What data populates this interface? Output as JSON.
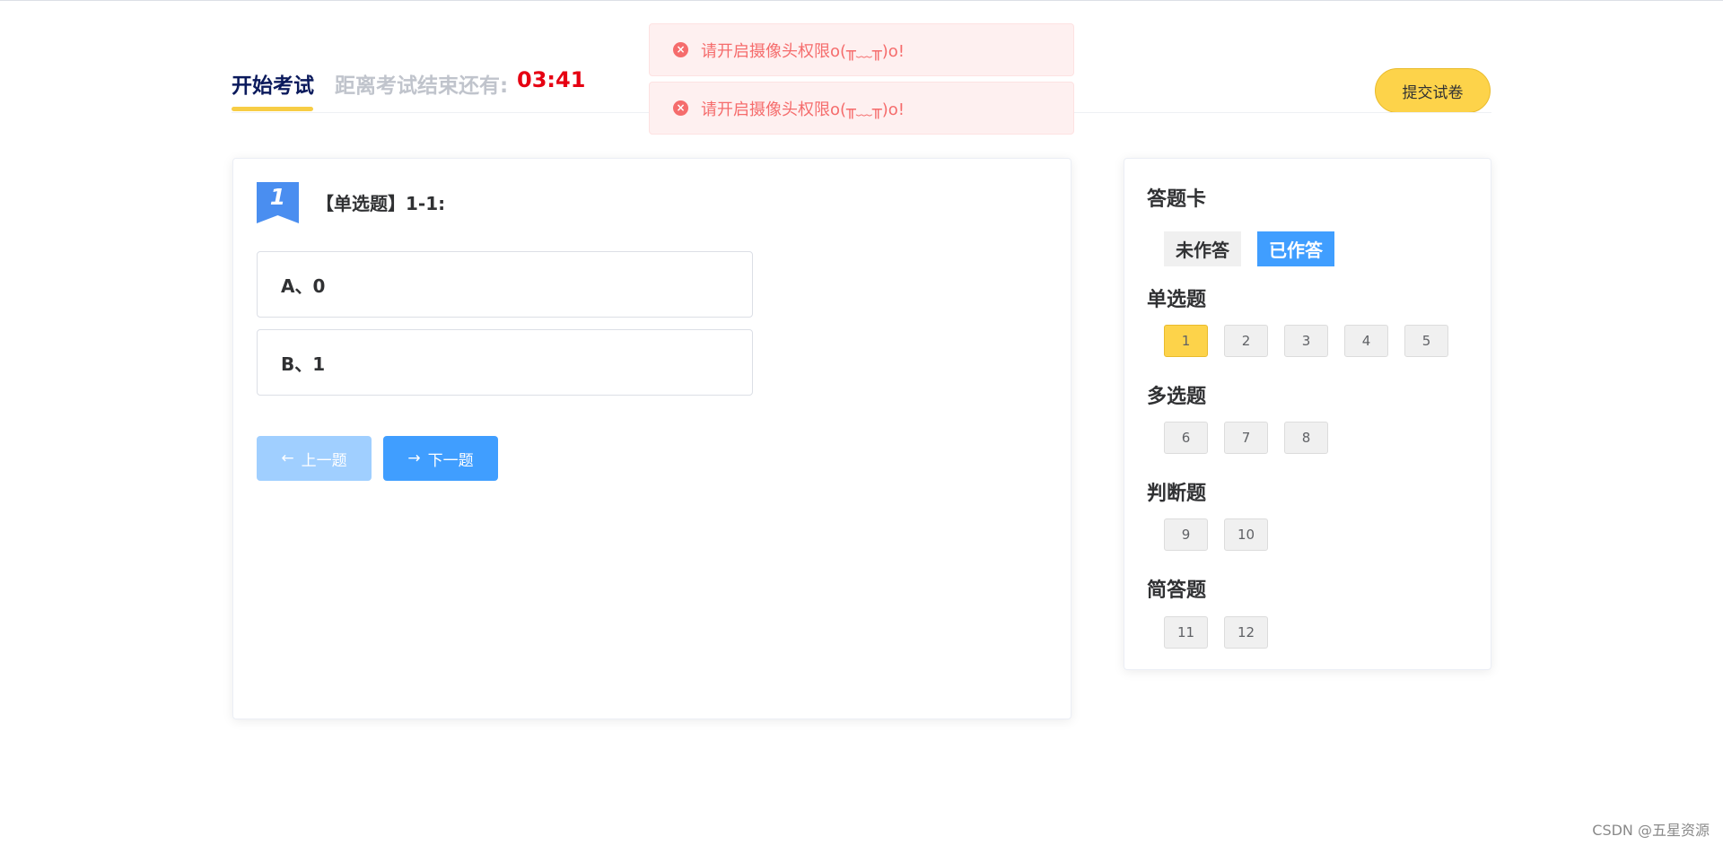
{
  "header": {
    "tab_label": "开始考试",
    "countdown_label": "距离考试结束还有:",
    "countdown_value": "03:41",
    "submit_label": "提交试卷"
  },
  "toasts": [
    {
      "icon": "close-circle-icon",
      "text": "请开启摄像头权限o(╥﹏╥)o!"
    },
    {
      "icon": "close-circle-icon",
      "text": "请开启摄像头权限o(╥﹏╥)o!"
    }
  ],
  "question": {
    "number": "1",
    "title": "【单选题】1-1:",
    "options": [
      {
        "label": "A、0"
      },
      {
        "label": "B、1"
      }
    ],
    "prev_label": "上一题",
    "next_label": "下一题"
  },
  "answer_card": {
    "title": "答题卡",
    "legend_unanswered": "未作答",
    "legend_answered": "已作答",
    "sections": [
      {
        "title": "单选题",
        "items": [
          "1",
          "2",
          "3",
          "4",
          "5"
        ],
        "current": "1"
      },
      {
        "title": "多选题",
        "items": [
          "6",
          "7",
          "8"
        ]
      },
      {
        "title": "判断题",
        "items": [
          "9",
          "10"
        ]
      },
      {
        "title": "简答题",
        "items": [
          "11",
          "12"
        ]
      }
    ]
  },
  "colors": {
    "accent_yellow": "#fdd34a",
    "primary_blue": "#409eff",
    "error_red": "#f56c6c",
    "countdown_red": "#e60012"
  },
  "watermark": "CSDN @五星资源"
}
